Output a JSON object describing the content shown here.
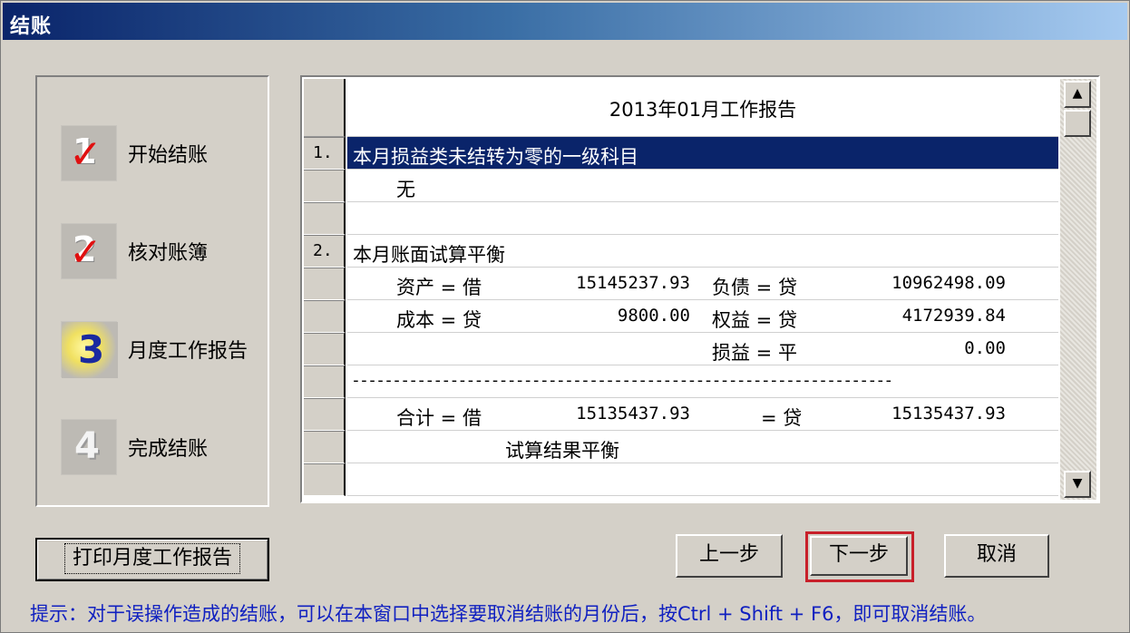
{
  "window": {
    "title": "结账"
  },
  "steps": [
    {
      "label": "开始结账",
      "icon": "red-check-1-icon"
    },
    {
      "label": "核对账簿",
      "icon": "red-check-2-icon"
    },
    {
      "label": "月度工作报告",
      "icon": "highlighted-3-icon"
    },
    {
      "label": "完成结账",
      "icon": "plain-4-icon"
    }
  ],
  "report": {
    "title": "2013年01月工作报告",
    "section1": {
      "num": "1.",
      "title": "本月损益类未结转为零的一级科目",
      "value": "无"
    },
    "section2": {
      "num": "2.",
      "title": "本月账面试算平衡",
      "asset_label": "资产 = 借",
      "asset_value": "15145237.93",
      "liability_label": "负债 = 贷",
      "liability_value": "10962498.09",
      "cost_label": "成本 = 贷",
      "cost_value": "9800.00",
      "equity_label": "权益 = 贷",
      "equity_value": "4172939.84",
      "pl_label": "损益 = 平",
      "pl_value": "0.00",
      "divider": "------------------------------------------------------------------",
      "total_label": "合计 = 借",
      "total_debit": "15135437.93",
      "total_credit_label": "= 贷",
      "total_credit": "15135437.93",
      "result": "试算结果平衡"
    }
  },
  "buttons": {
    "print": "打印月度工作报告",
    "prev": "上一步",
    "next": "下一步",
    "cancel": "取消"
  },
  "hint": "提示：对于误操作造成的结账，可以在本窗口中选择要取消结账的月份后，按Ctrl + Shift + F6，即可取消结账。",
  "colors": {
    "title_start": "#0a246a",
    "title_end": "#a6caf0",
    "highlight_row": "#0a246a",
    "hint_text": "#1020c0",
    "next_frame": "#c8202a",
    "check_red": "#e01010"
  }
}
